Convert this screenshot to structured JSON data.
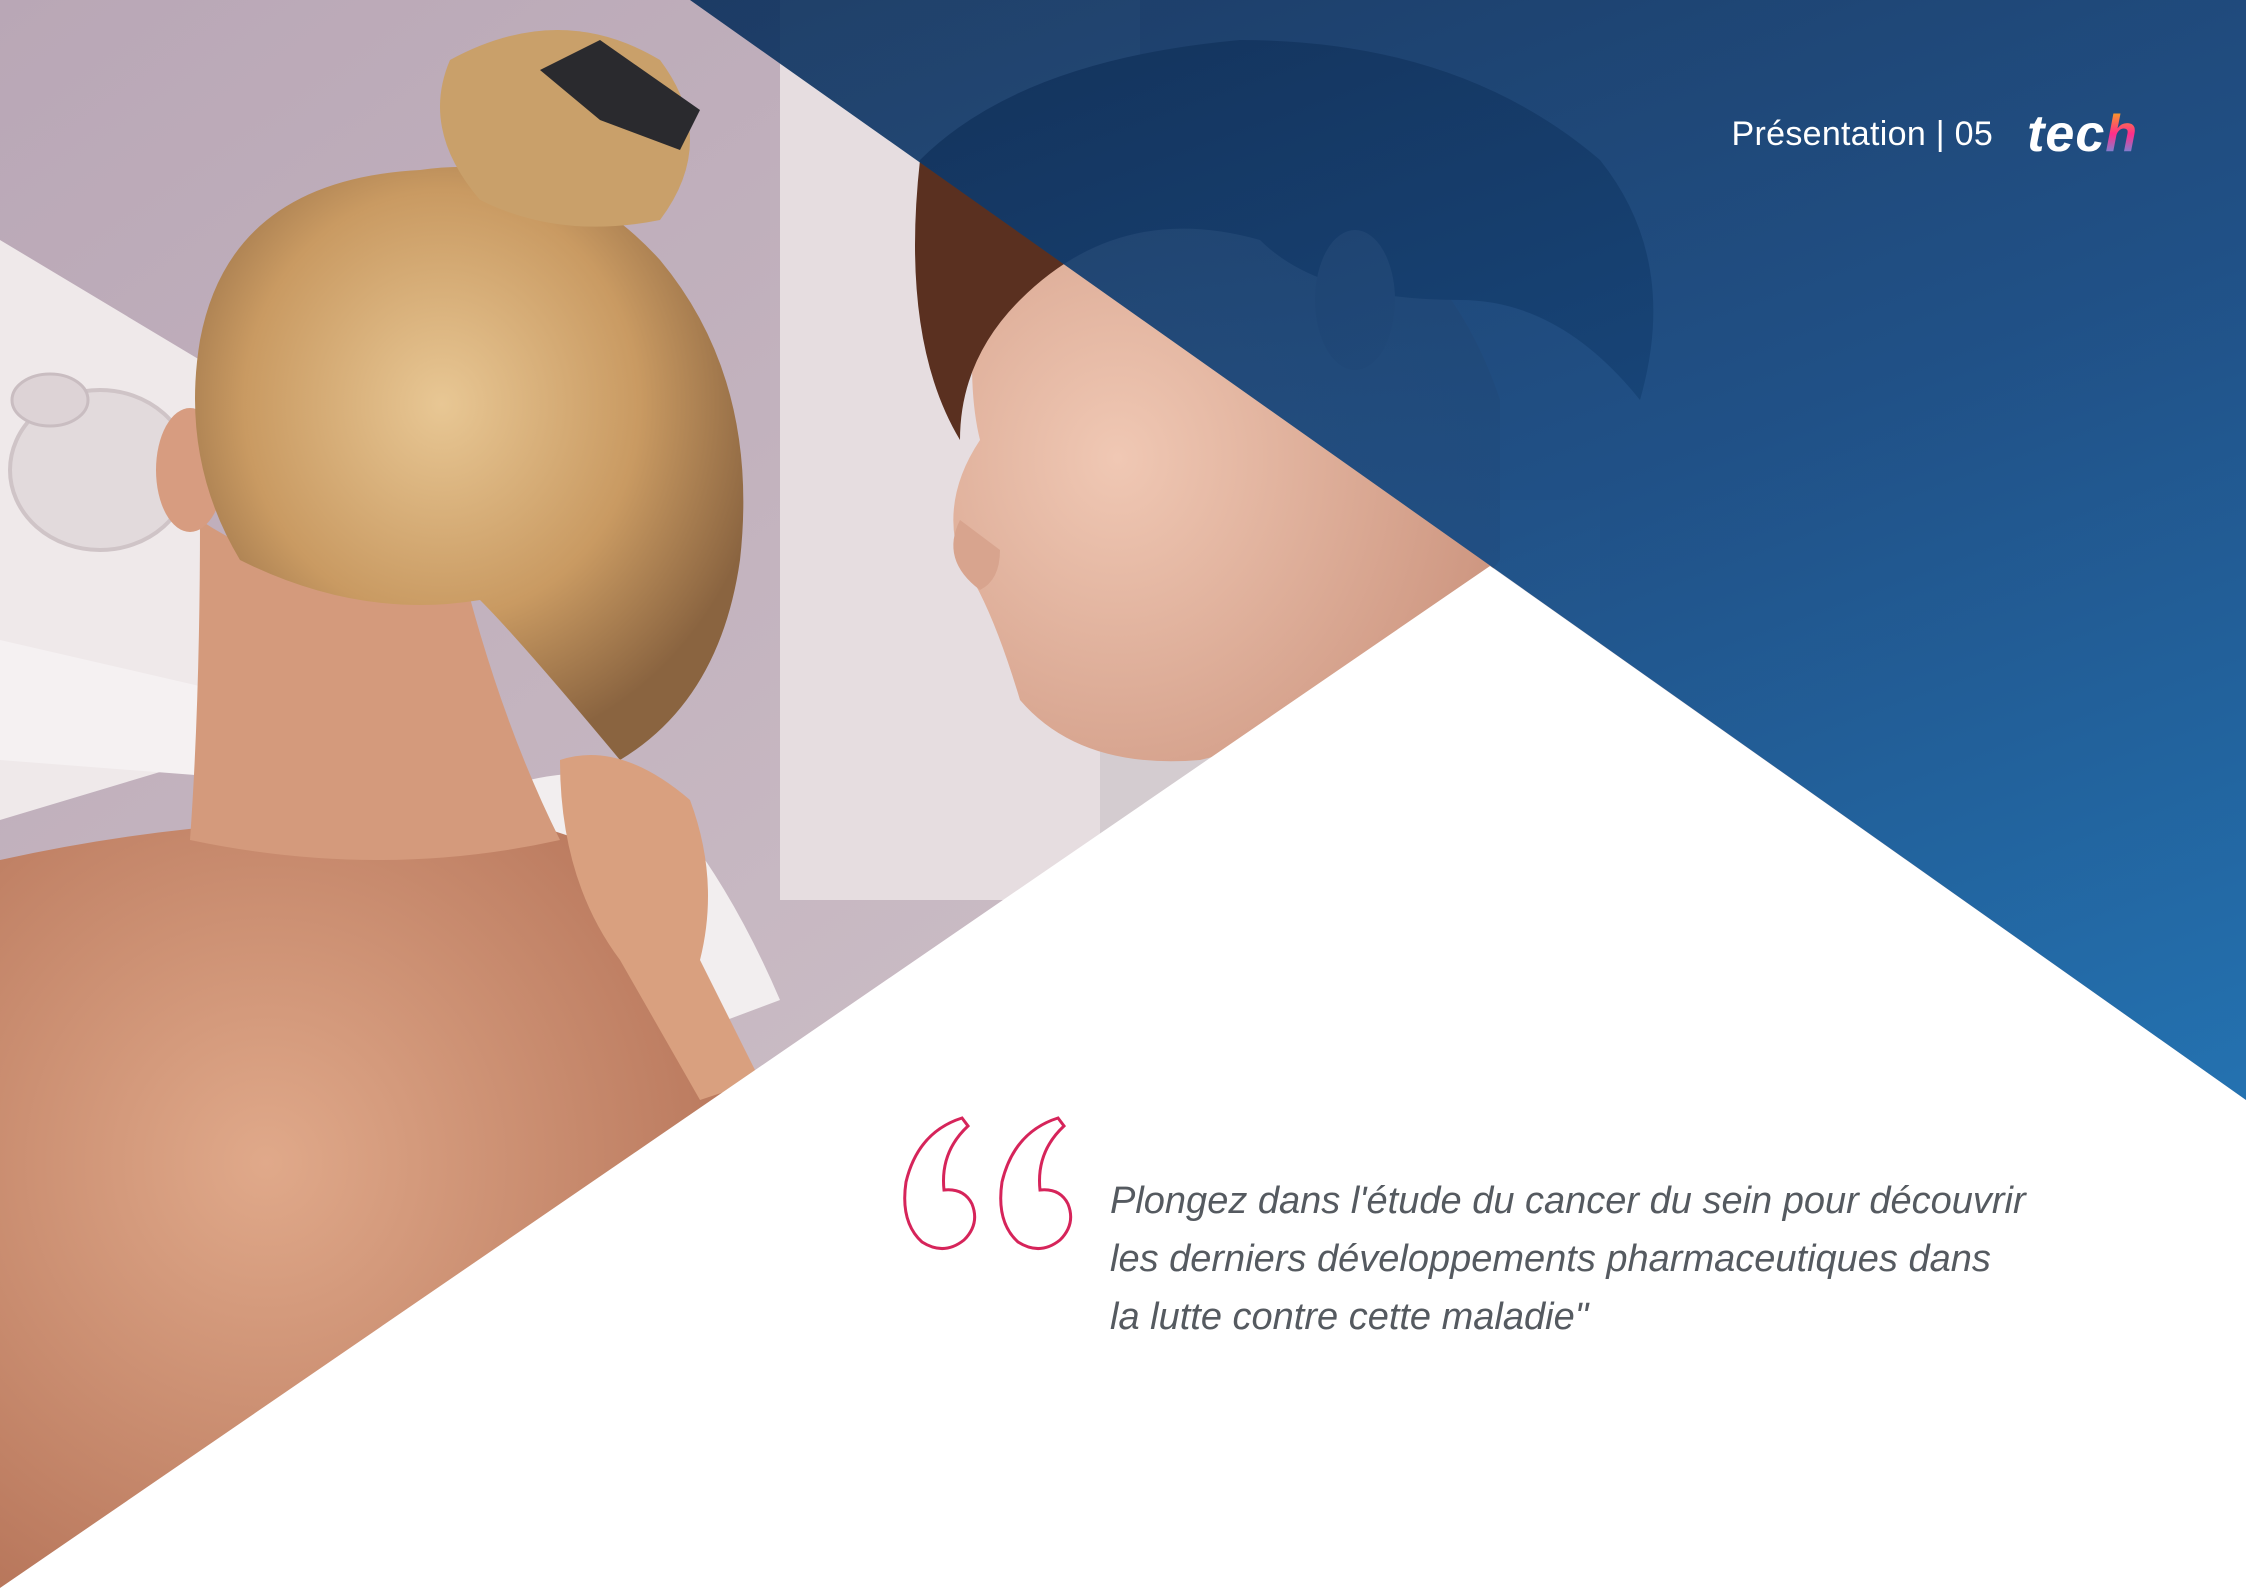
{
  "header": {
    "section_label": "Présentation | 05",
    "logo_text": "tec",
    "logo_accent": "h"
  },
  "quote": {
    "lines": [
      "Plongez dans l'étude du cancer du sein pour découvrir",
      "les derniers développements pharmaceutiques dans",
      "la lutte contre cette maladie\""
    ]
  },
  "colors": {
    "blue_dark": "#0a2850",
    "blue_light": "#1e82c8",
    "quote_mark": "#d6245a",
    "quote_text": "#555a60"
  },
  "icons": {
    "quote": "open-quote-icon"
  }
}
